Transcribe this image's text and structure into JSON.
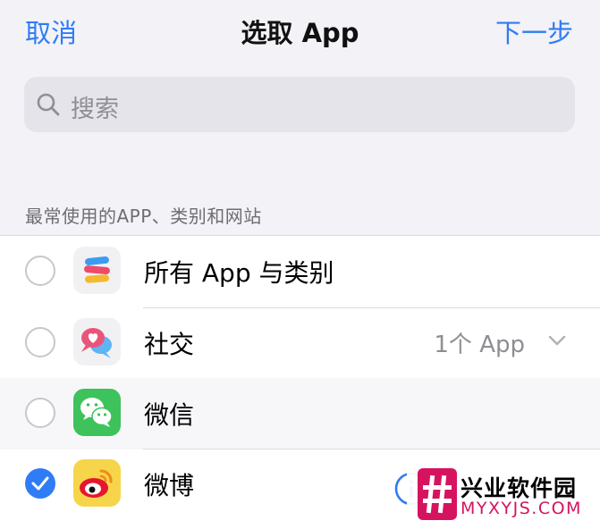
{
  "nav": {
    "cancel_label": "取消",
    "title": "选取 App",
    "next_label": "下一步"
  },
  "search": {
    "placeholder": "搜索"
  },
  "section": {
    "header": "最常使用的APP、类别和网站"
  },
  "rows": [
    {
      "label": "所有 App 与类别",
      "detail": "",
      "selected": false,
      "icon": "stack-layers-icon"
    },
    {
      "label": "社交",
      "detail": "1个 App",
      "selected": false,
      "icon": "chat-bubbles-heart-icon"
    },
    {
      "label": "微信",
      "detail": "",
      "selected": false,
      "icon": "wechat-icon"
    },
    {
      "label": "微博",
      "detail": "",
      "selected": true,
      "icon": "weibo-icon"
    }
  ],
  "colors": {
    "accent": "#2f7cf6",
    "background": "#f2f2f7",
    "watermark_pink": "#d6135f"
  },
  "watermark": {
    "title": "兴业软件园",
    "subtitle": "MYXYJS.COM"
  }
}
